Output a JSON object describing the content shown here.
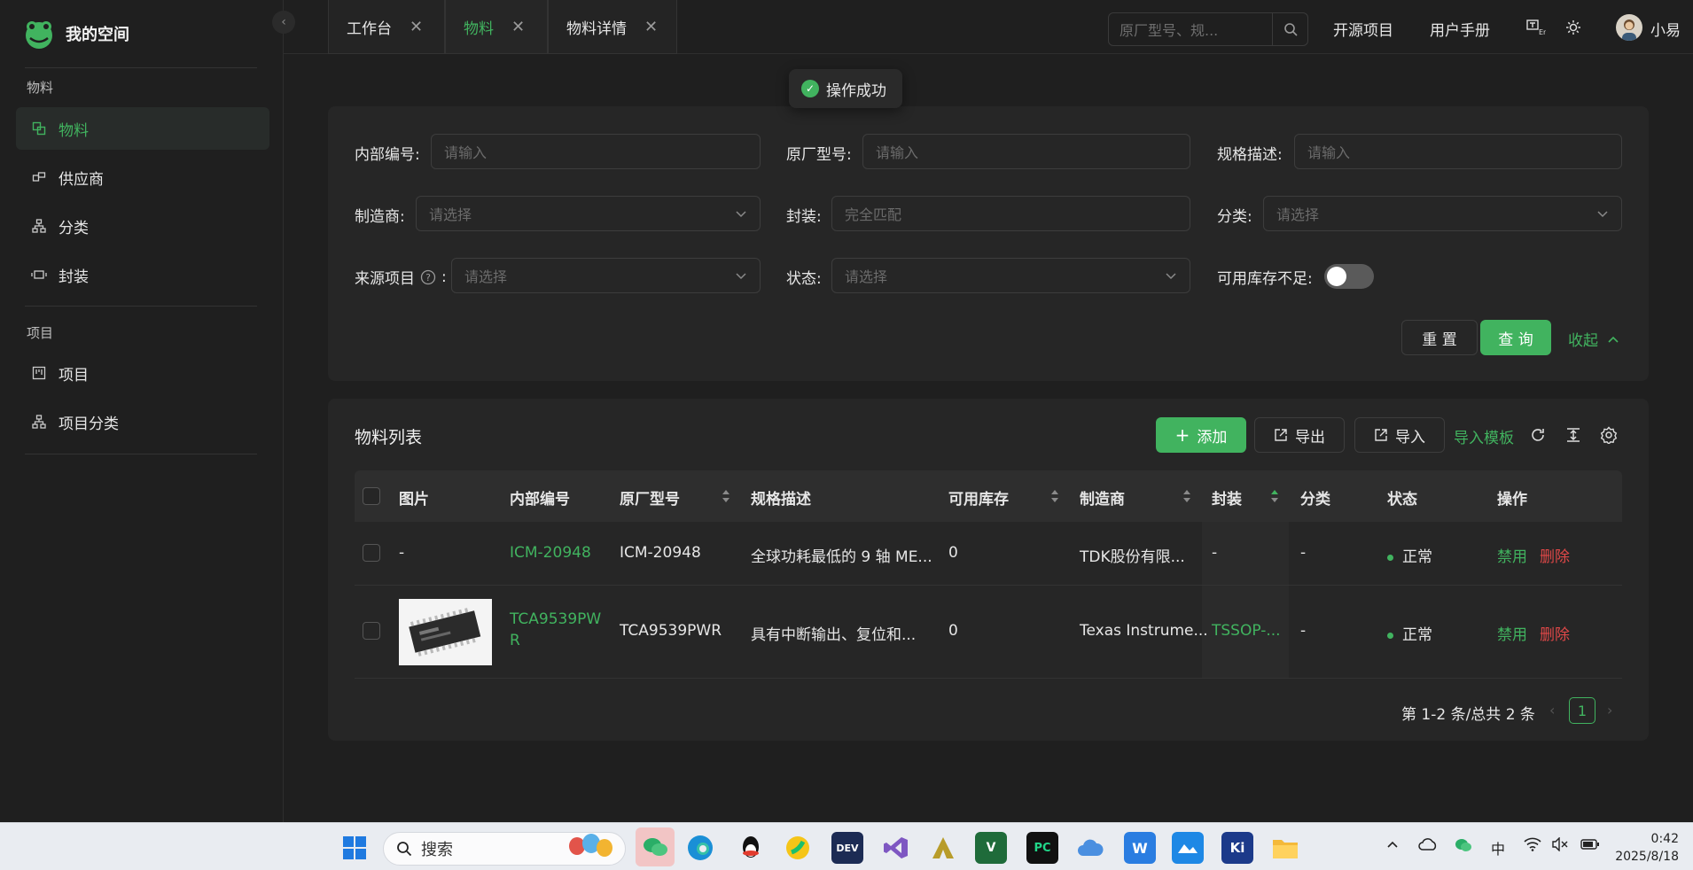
{
  "app": {
    "title": "我的空间",
    "accent": "#41b35f",
    "danger": "#e04848"
  },
  "sidebar": {
    "groups": [
      {
        "label": "物料",
        "items": [
          {
            "label": "物料",
            "icon": "material-icon",
            "active": true
          },
          {
            "label": "供应商",
            "icon": "supplier-icon"
          },
          {
            "label": "分类",
            "icon": "category-icon"
          },
          {
            "label": "封装",
            "icon": "package-icon"
          }
        ]
      },
      {
        "label": "项目",
        "items": [
          {
            "label": "项目",
            "icon": "project-icon"
          },
          {
            "label": "项目分类",
            "icon": "project-category-icon"
          }
        ]
      }
    ]
  },
  "tabs": [
    {
      "label": "工作台",
      "active": false
    },
    {
      "label": "物料",
      "active": true
    },
    {
      "label": "物料详情",
      "active": false
    }
  ],
  "header": {
    "search_placeholder": "原厂型号、规...",
    "links": [
      "开源项目",
      "用户手册"
    ],
    "username": "小易"
  },
  "toast": {
    "message": "操作成功"
  },
  "filters": {
    "internal_no": {
      "label": "内部编号",
      "placeholder": "请输入"
    },
    "mfr_part": {
      "label": "原厂型号",
      "placeholder": "请输入"
    },
    "spec": {
      "label": "规格描述",
      "placeholder": "请输入"
    },
    "manufacturer": {
      "label": "制造商",
      "placeholder": "请选择"
    },
    "package": {
      "label": "封装",
      "placeholder": "完全匹配"
    },
    "category": {
      "label": "分类",
      "placeholder": "请选择"
    },
    "source_project": {
      "label": "来源项目",
      "placeholder": "请选择"
    },
    "status": {
      "label": "状态",
      "placeholder": "请选择"
    },
    "low_stock": {
      "label": "可用库存不足",
      "value": false
    },
    "reset_label": "重 置",
    "query_label": "查 询",
    "collapse_label": "收起"
  },
  "table": {
    "title": "物料列表",
    "actions": {
      "add": "添加",
      "export": "导出",
      "import": "导入",
      "template": "导入模板"
    },
    "columns": [
      "图片",
      "内部编号",
      "原厂型号",
      "规格描述",
      "可用库存",
      "制造商",
      "封装",
      "分类",
      "状态",
      "操作"
    ],
    "rows": [
      {
        "image": "-",
        "internal_no": "ICM-20948",
        "mfr_part": "ICM-20948",
        "spec": "全球功耗最低的 9 轴 ME...",
        "stock": "0",
        "manufacturer": "TDK股份有限...",
        "package": "-",
        "category": "-",
        "status": "正常",
        "op_disable": "禁用",
        "op_delete": "删除"
      },
      {
        "image": "chip-photo",
        "internal_no_1": "TCA9539PW",
        "internal_no_2": "R",
        "mfr_part": "TCA9539PWR",
        "spec": "具有中断输出、复位和...",
        "stock": "0",
        "manufacturer": "Texas Instrume...",
        "package": "TSSOP-...",
        "category": "-",
        "status": "正常",
        "op_disable": "禁用",
        "op_delete": "删除"
      }
    ]
  },
  "pagination": {
    "summary": "第 1-2 条/总共 2 条",
    "current": "1"
  },
  "taskbar": {
    "search_label": "搜索",
    "ime": "中",
    "time": "0:42",
    "date": "2025/8/18"
  }
}
